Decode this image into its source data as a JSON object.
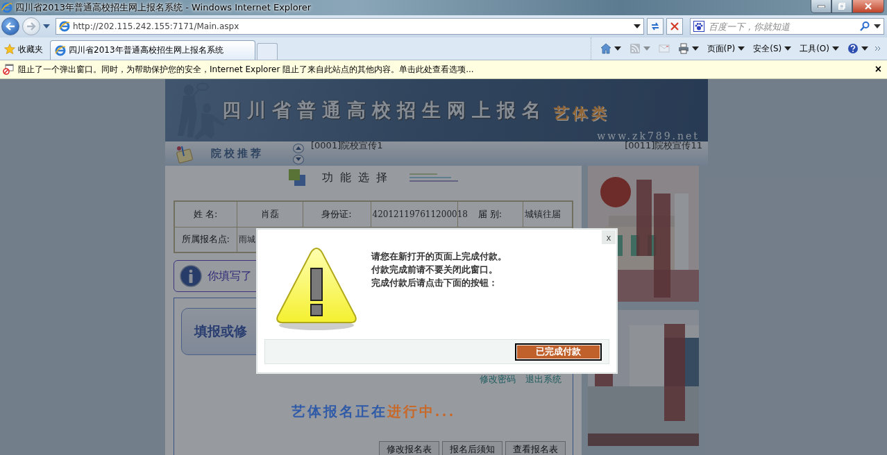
{
  "window": {
    "title": "四川省2013年普通高校招生网上报名系统 - Windows Internet Explorer"
  },
  "address_bar": {
    "url": "http://202.115.242.155:7171/Main.aspx"
  },
  "search": {
    "placeholder": "百度一下，你就知道"
  },
  "favorites": {
    "label": "收藏夹"
  },
  "tabs": [
    {
      "label": "四川省2013年普通高校招生网上报名系统",
      "selected": true
    }
  ],
  "command_bar": [
    {
      "kind": "home",
      "disabled": false
    },
    {
      "kind": "feeds",
      "disabled": true
    },
    {
      "kind": "mail",
      "disabled": true
    },
    {
      "kind": "print",
      "disabled": false
    },
    {
      "kind": "menu",
      "label": "页面(P)",
      "disabled": false
    },
    {
      "kind": "menu",
      "label": "安全(S)",
      "disabled": false
    },
    {
      "kind": "menu",
      "label": "工具(O)",
      "disabled": false
    },
    {
      "kind": "help",
      "disabled": false
    }
  ],
  "info_bar": {
    "text": "阻止了一个弹出窗口。同时，为帮助保护您的安全，Internet Explorer 阻止了来自此站点的其他内容。单击此处查看选项...",
    "close": "×"
  },
  "banner": {
    "title": "四川省普通高校招生网上报名",
    "category": "艺体类",
    "site": "www.zk789.net"
  },
  "recommend": {
    "label": "院校推荐",
    "items": [
      "[0001]院校宣传1",
      "[0011]院校宣传11"
    ]
  },
  "section_title": "功能选择",
  "student_info": [
    [
      "姓  名:",
      "肖磊",
      "身份证:",
      "420121197611200018",
      "届  别:",
      "城镇往届"
    ],
    [
      "所属报名点:",
      "雨城"
    ]
  ],
  "notice": "你填写了",
  "fill_button": "填报或修",
  "links": [
    "修改密码",
    "退出系统"
  ],
  "status_banner": [
    {
      "text": "艺体报名正在",
      "color": "#2f5aa8"
    },
    {
      "text": "进行中...",
      "color": "#c8692a"
    }
  ],
  "bottom_tabs": [
    "修改报名表",
    "报名后须知",
    "查看报名表"
  ],
  "ads": [
    {
      "kind": "picture"
    },
    {
      "kind": "picture"
    }
  ],
  "dialog": {
    "close": "x",
    "lines": [
      "请您在新打开的页面上完成付款。",
      "付款完成前请不要关闭此窗口。",
      "完成付款后请点击下面的按钮："
    ],
    "button": "已完成付款"
  }
}
